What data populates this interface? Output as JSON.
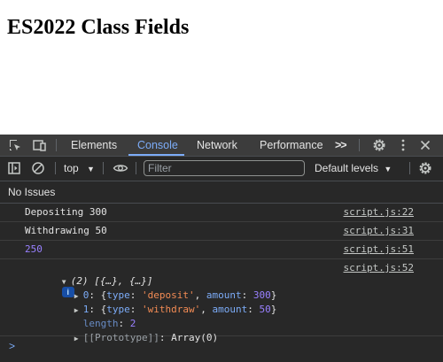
{
  "page": {
    "heading": "ES2022 Class Fields"
  },
  "devtools": {
    "tabs": [
      "Elements",
      "Console",
      "Network",
      "Performance"
    ],
    "more_tabs": ">>",
    "toolbar": {
      "context": "top",
      "filter_placeholder": "Filter",
      "levels": "Default levels"
    },
    "issues": "No Issues",
    "console": [
      {
        "text": "Depositing 300",
        "source": "script.js:22"
      },
      {
        "text": "Withdrawing 50",
        "source": "script.js:31"
      },
      {
        "text": "250",
        "source": "script.js:51"
      }
    ],
    "array_log": {
      "summary": "(2) [{…}, {…}]",
      "source": "script.js:52",
      "info_badge": "i",
      "items": [
        {
          "index": "0",
          "type": "'deposit'",
          "amount": "300"
        },
        {
          "index": "1",
          "type": "'withdraw'",
          "amount": "50"
        }
      ],
      "labels": {
        "type": "type",
        "amount": "amount"
      },
      "length_key": "length",
      "length_value": "2",
      "prototype_key": "[[Prototype]]",
      "prototype_value": "Array(0)"
    },
    "prompt": ">"
  },
  "colors": {
    "accent": "#7cacf8",
    "background": "#282828",
    "number": "#9980ff",
    "string": "#f28b54"
  }
}
